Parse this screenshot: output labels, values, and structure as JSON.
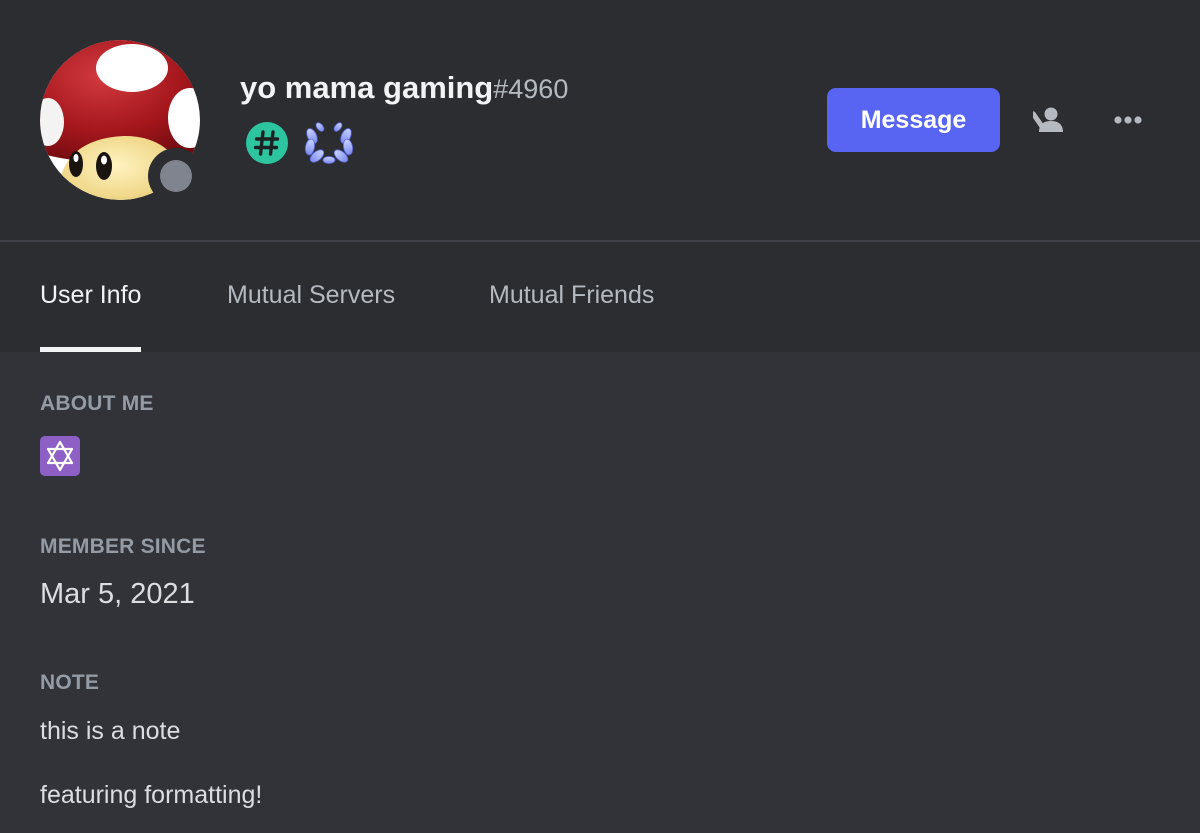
{
  "user": {
    "username": "yo mama gaming",
    "discriminator": "#4960",
    "status": "offline",
    "status_color": "#80848e",
    "avatar_icon": "toad-mushroom-avatar"
  },
  "badges": [
    {
      "icon": "hypesquad-hash-badge",
      "color": "#2dc5a0"
    },
    {
      "icon": "laurel-wreath-badge",
      "color": "#a7b3f5"
    }
  ],
  "actions": {
    "message_label": "Message",
    "friend_icon": "add-friend-icon",
    "more_icon": "more-options-icon"
  },
  "tabs": [
    {
      "label": "User Info",
      "active": true
    },
    {
      "label": "Mutual Servers",
      "active": false
    },
    {
      "label": "Mutual Friends",
      "active": false
    }
  ],
  "sections": {
    "about_me": {
      "title": "ABOUT ME",
      "emoji_icon": "star-of-david-icon"
    },
    "member_since": {
      "title": "MEMBER SINCE",
      "date": "Mar 5, 2021"
    },
    "note": {
      "title": "NOTE",
      "lines": [
        "this is a note",
        "featuring formatting!"
      ]
    }
  },
  "colors": {
    "accent": "#5865f2",
    "background": "#313338",
    "header": "#2b2d31"
  }
}
